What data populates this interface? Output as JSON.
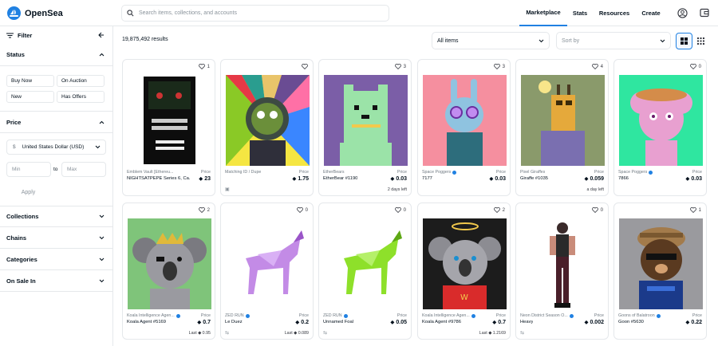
{
  "header": {
    "logo_text": "OpenSea",
    "search_placeholder": "Search items, collections, and accounts",
    "nav": [
      "Marketplace",
      "Stats",
      "Resources",
      "Create"
    ]
  },
  "sidebar": {
    "filter_label": "Filter",
    "status_label": "Status",
    "status_options": [
      "Buy Now",
      "On Auction",
      "New",
      "Has Offers"
    ],
    "price_label": "Price",
    "currency": "United States Dollar (USD)",
    "currency_symbol": "$",
    "min_placeholder": "Min",
    "to_label": "to",
    "max_placeholder": "Max",
    "apply_label": "Apply",
    "collections_label": "Collections",
    "chains_label": "Chains",
    "categories_label": "Categories",
    "on_sale_label": "On Sale In"
  },
  "main": {
    "results": "19,875,492 results",
    "filter_select": "All items",
    "sort_placeholder": "Sort by"
  },
  "cards": [
    {
      "favorites": "1",
      "collection": "Emblem Vault [Ethereu...",
      "verified": false,
      "name": "NIGHTSATPEPE Series 6, Ca...",
      "price_label": "Price",
      "price": "23",
      "footer_left": "",
      "footer_right": ""
    },
    {
      "favorites": "",
      "collection": "Matching ID / Dupe",
      "verified": false,
      "name": "",
      "price_label": "Price",
      "price": "1.75",
      "footer_left": "▣",
      "footer_right": ""
    },
    {
      "favorites": "3",
      "collection": "EtherBears",
      "verified": false,
      "name": "EtherBear #1190",
      "price_label": "Price",
      "price": "0.03",
      "footer_left": "",
      "footer_right": "2 days left"
    },
    {
      "favorites": "3",
      "collection": "Space Poggers",
      "verified": true,
      "name": "7177",
      "price_label": "Price",
      "price": "0.03",
      "footer_left": "",
      "footer_right": ""
    },
    {
      "favorites": "4",
      "collection": "Pixel Giraffes",
      "verified": false,
      "name": "Giraffe #1035",
      "price_label": "Price",
      "price": "0.059",
      "footer_left": "",
      "footer_right": "a day left"
    },
    {
      "favorites": "0",
      "collection": "Space Poggers",
      "verified": true,
      "name": "7866",
      "price_label": "Price",
      "price": "0.03",
      "footer_left": "",
      "footer_right": ""
    },
    {
      "favorites": "2",
      "collection": "Koala Intelligence Agen...",
      "verified": true,
      "name": "Koala Agent #5169",
      "price_label": "Price",
      "price": "0.7",
      "footer_left": "",
      "footer_right": "Last ◆ 0.95"
    },
    {
      "favorites": "0",
      "collection": "ZED RUN",
      "verified": true,
      "name": "Le Duez",
      "price_label": "Price",
      "price": "0.2",
      "footer_left": "⇆",
      "footer_right": "Last ◆ 0.089"
    },
    {
      "favorites": "0",
      "collection": "ZED RUN",
      "verified": true,
      "name": "Unnamed Foal",
      "price_label": "Price",
      "price": "0.05",
      "footer_left": "⇆",
      "footer_right": ""
    },
    {
      "favorites": "2",
      "collection": "Koala Intelligence Agen...",
      "verified": true,
      "name": "Koala Agent #9786",
      "price_label": "Price",
      "price": "0.7",
      "footer_left": "",
      "footer_right": "Last ◆ 1.2169"
    },
    {
      "favorites": "0",
      "collection": "Neon District Season O...",
      "verified": true,
      "name": "Heavy",
      "price_label": "Price",
      "price": "0.002",
      "footer_left": "⇆",
      "footer_right": ""
    },
    {
      "favorites": "1",
      "collection": "Goons of Balatroon",
      "verified": true,
      "name": "Goon #5630",
      "price_label": "Price",
      "price": "0.22",
      "footer_left": "",
      "footer_right": ""
    }
  ],
  "colors": {
    "accent": "#2081e2",
    "border": "#e5e8eb",
    "text": "#04111d",
    "muted": "#707a83"
  }
}
